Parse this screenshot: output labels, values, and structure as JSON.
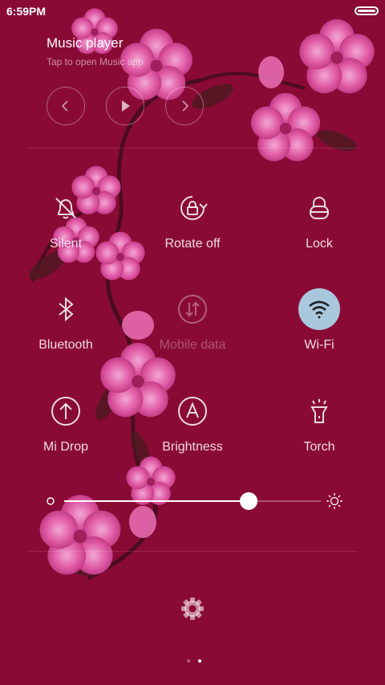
{
  "status": {
    "time": "6:59PM"
  },
  "music": {
    "title": "Music player",
    "subtitle": "Tap to open Music app"
  },
  "toggles": [
    {
      "label": "Silent",
      "icon": "bell-off-icon",
      "state": "off"
    },
    {
      "label": "Rotate off",
      "icon": "rotate-lock-icon",
      "state": "off"
    },
    {
      "label": "Lock",
      "icon": "lock-icon",
      "state": "off"
    },
    {
      "label": "Bluetooth",
      "icon": "bluetooth-icon",
      "state": "off"
    },
    {
      "label": "Mobile data",
      "icon": "mobile-data-icon",
      "state": "disabled"
    },
    {
      "label": "Wi-Fi",
      "icon": "wifi-icon",
      "state": "on"
    },
    {
      "label": "Mi Drop",
      "icon": "mi-drop-icon",
      "state": "off"
    },
    {
      "label": "Brightness",
      "icon": "auto-brightness-icon",
      "state": "off"
    },
    {
      "label": "Torch",
      "icon": "torch-icon",
      "state": "off"
    }
  ],
  "brightness": {
    "level": 0.72
  },
  "pager": {
    "pages": 2,
    "current": 2
  },
  "colors": {
    "background": "#8a0a36",
    "wifi_active": "#a9c8de",
    "flower": "#e060a8"
  }
}
